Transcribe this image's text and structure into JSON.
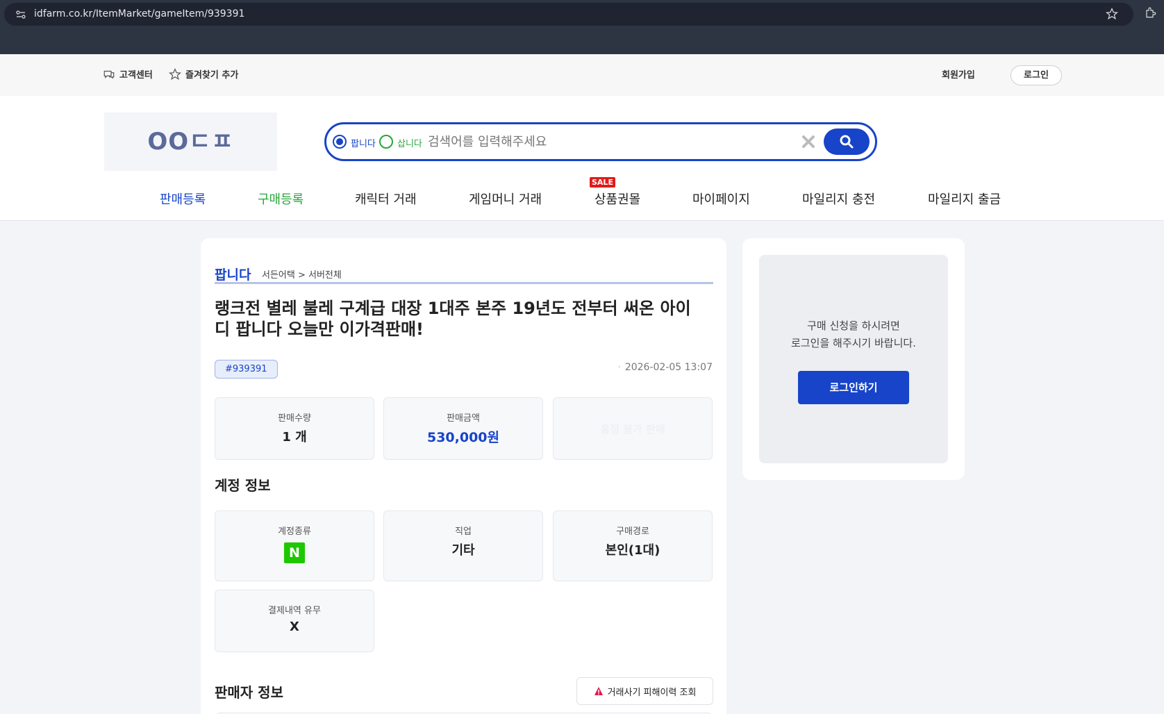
{
  "browser": {
    "url": "idfarm.co.kr/ItemMarket/gameItem/939391"
  },
  "util": {
    "customer_center": "고객센터",
    "add_favorite": "즐겨찾기 추가",
    "signup": "회원가입",
    "login": "로그인"
  },
  "header": {
    "logo_text": "OOㄷㅍ",
    "search": {
      "radio_sell": "팝니다",
      "radio_buy": "삽니다",
      "selected": "팝니다",
      "placeholder": "검색어를 입력해주세요",
      "value": ""
    },
    "nav": [
      {
        "label": "판매등록",
        "color": "#1744c8"
      },
      {
        "label": "구매등록",
        "color": "#27a63a"
      },
      {
        "label": "캐릭터 거래"
      },
      {
        "label": "게임머니 거래"
      },
      {
        "label": "상품권몰",
        "badge": "SALE"
      },
      {
        "label": "마이페이지"
      },
      {
        "label": "마일리지 충전"
      },
      {
        "label": "마일리지 출금"
      }
    ]
  },
  "item": {
    "type": "팝니다",
    "path": "서든어택 > 서버전체",
    "title": "랭크전 별레 불레 구계급 대장 1대주 본주 19년도 전부터 써온 아이디 팝니다 오늘만 이가격판매!",
    "id": "#939391",
    "date": "2026-02-05 13:07",
    "stats": [
      {
        "label": "판매수량",
        "value": "1 개"
      },
      {
        "label": "판매금액",
        "value": "530,000원"
      },
      {
        "label": "",
        "value": "흥정 불가 판매"
      }
    ]
  },
  "account": {
    "title": "계정 정보",
    "fields": [
      {
        "label": "계정종류",
        "value": "N"
      },
      {
        "label": "직업",
        "value": "기타"
      },
      {
        "label": "구매경로",
        "value": "본인(1대)"
      },
      {
        "label": "결제내역 유무",
        "value": "X"
      }
    ]
  },
  "seller": {
    "title": "판매자 정보",
    "scam_check": "거래사기 피해이력 조회"
  },
  "side": {
    "msg_line1": "구매 신청을 하시려면",
    "msg_line2": "로그인을 해주시기 바랍니다.",
    "login_button": "로그인하기"
  },
  "colors": {
    "brand_blue": "#1744c8",
    "buy_green": "#27a63a",
    "naver_green": "#1ec800",
    "sale_red": "#e11b1b"
  }
}
